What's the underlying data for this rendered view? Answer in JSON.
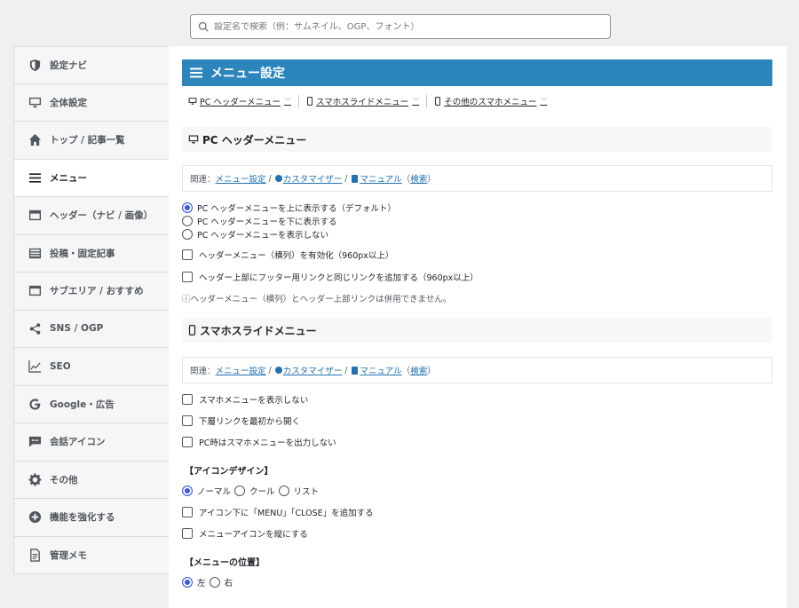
{
  "search": {
    "placeholder": "設定名で検索（例：サムネイル、OGP、フォント）"
  },
  "sidebar": {
    "items": [
      {
        "label": "設定ナビ",
        "icon": "shield-icon"
      },
      {
        "label": "全体設定",
        "icon": "monitor-icon"
      },
      {
        "label": "トップ / 記事一覧",
        "icon": "home-icon"
      },
      {
        "label": "メニュー",
        "icon": "menu-icon"
      },
      {
        "label": "ヘッダー（ナビ / 画像）",
        "icon": "header-icon"
      },
      {
        "label": "投稿・固定記事",
        "icon": "post-icon"
      },
      {
        "label": "サブエリア / おすすめ",
        "icon": "subarea-icon"
      },
      {
        "label": "SNS / OGP",
        "icon": "share-icon"
      },
      {
        "label": "SEO",
        "icon": "chart-icon"
      },
      {
        "label": "Google・広告",
        "icon": "google-icon"
      },
      {
        "label": "会話アイコン",
        "icon": "chat-icon"
      },
      {
        "label": "その他",
        "icon": "gear-icon"
      },
      {
        "label": "機能を強化する",
        "icon": "plus-circle-icon"
      },
      {
        "label": "管理メモ",
        "icon": "memo-icon"
      }
    ],
    "active_index": 3
  },
  "main": {
    "title": "メニュー設定",
    "tabs": [
      {
        "label": "PC ヘッダーメニュー"
      },
      {
        "label": "スマホスライドメニュー"
      },
      {
        "label": "その他のスマホメニュー"
      }
    ],
    "pc_section": {
      "heading": "PC ヘッダーメニュー",
      "related_prefix": "関連：",
      "link_menu": "メニュー設定",
      "link_customizer": "カスタマイザー",
      "link_manual": "マニュアル",
      "link_search": "検索",
      "radio_top": "PC ヘッダーメニューを上に表示する（デフォルト）",
      "radio_bottom": "PC ヘッダーメニューを下に表示する",
      "radio_hide": "PC ヘッダーメニューを表示しない",
      "check_horizontal": "ヘッダーメニュー（横列）を有効化（960px以上）",
      "check_footer_links": "ヘッダー上部にフッター用リンクと同じリンクを追加する（960px以上）",
      "note": "ⓘヘッダーメニュー（横列）とヘッダー上部リンクは併用できません。"
    },
    "sp_section": {
      "heading": "スマホスライドメニュー",
      "related_prefix": "関連：",
      "link_menu": "メニュー設定",
      "link_customizer": "カスタマイザー",
      "link_manual": "マニュアル",
      "link_search": "検索",
      "check_hide": "スマホメニューを表示しない",
      "check_open": "下層リンクを最初から開く",
      "check_no_pc": "PC時はスマホメニューを出力しない",
      "icon_design_title": "【アイコンデザイン】",
      "design_normal": "ノーマル",
      "design_cool": "クール",
      "design_list": "リスト",
      "check_menu_close": "アイコン下に「MENU」「CLOSE」を追加する",
      "check_vertical": "メニューアイコンを縦にする",
      "position_title": "【メニューの位置】",
      "pos_left": "左",
      "pos_right": "右"
    }
  },
  "colors": {
    "accent": "#2c86bb",
    "radio": "#3858e9",
    "link": "#2271b1"
  }
}
